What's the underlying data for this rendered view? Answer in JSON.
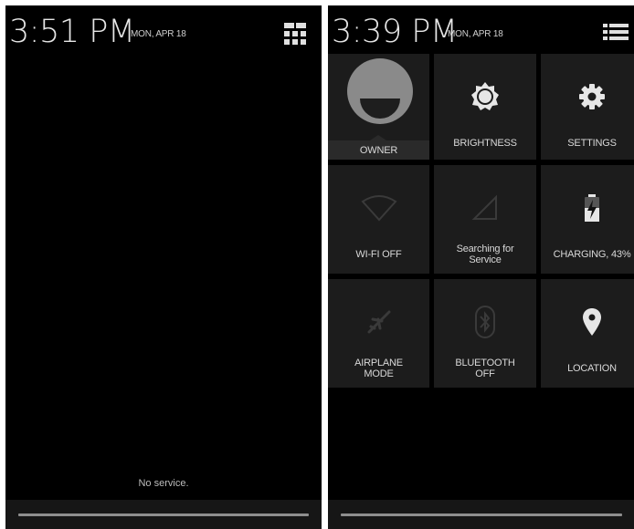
{
  "lockscreen": {
    "time": "3:51 PM",
    "date": "MON, APR 18",
    "status_message": "No service.",
    "icon": "quick-settings-grid-icon"
  },
  "quick_settings": {
    "time": "3:39 PM",
    "date": "MON, APR 18",
    "icon": "notifications-list-icon",
    "tiles": [
      {
        "label": "OWNER",
        "icon": "user-avatar-icon"
      },
      {
        "label": "BRIGHTNESS",
        "icon": "brightness-icon"
      },
      {
        "label": "SETTINGS",
        "icon": "gear-icon"
      },
      {
        "label": "WI-FI OFF",
        "icon": "wifi-off-icon"
      },
      {
        "label_line1": "Searching for",
        "label_line2": "Service",
        "icon": "signal-icon"
      },
      {
        "label": "CHARGING, 43%",
        "icon": "battery-charging-icon"
      },
      {
        "label_line1": "AIRPLANE",
        "label_line2": "MODE",
        "icon": "airplane-icon"
      },
      {
        "label_line1": "BLUETOOTH",
        "label_line2": "OFF",
        "icon": "bluetooth-icon"
      },
      {
        "label": "LOCATION",
        "icon": "location-pin-icon"
      }
    ]
  },
  "colors": {
    "background": "#000000",
    "tile": "#1c1c1c",
    "text": "#d8d8d8",
    "dim_icon": "#3a3a3a"
  }
}
